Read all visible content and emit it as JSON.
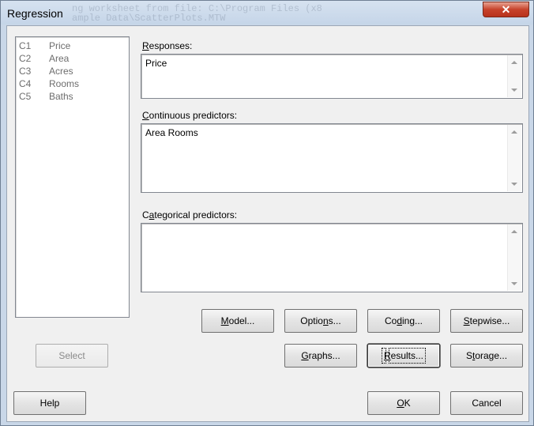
{
  "window": {
    "title": "Regression",
    "close_glyph": "✕",
    "background_ghost_text": "ng worksheet from file: C:\\Program Files (x8\nample Data\\ScatterPlots.MTW"
  },
  "variables": [
    {
      "col": "C1",
      "name": "Price"
    },
    {
      "col": "C2",
      "name": "Area"
    },
    {
      "col": "C3",
      "name": "Acres"
    },
    {
      "col": "C4",
      "name": "Rooms"
    },
    {
      "col": "C5",
      "name": "Baths"
    }
  ],
  "fields": {
    "responses": {
      "label_pre": "",
      "label_hot": "R",
      "label_post": "esponses:",
      "value": "Price"
    },
    "continuous": {
      "label_pre": "",
      "label_hot": "C",
      "label_post": "ontinuous predictors:",
      "value": "Area Rooms"
    },
    "categorical": {
      "label_pre": "C",
      "label_hot": "a",
      "label_post": "tegorical predictors:",
      "value": ""
    }
  },
  "buttons": {
    "model": {
      "pre": "",
      "hot": "M",
      "post": "odel..."
    },
    "options": {
      "pre": "Optio",
      "hot": "n",
      "post": "s..."
    },
    "coding": {
      "pre": "Co",
      "hot": "d",
      "post": "ing..."
    },
    "stepwise": {
      "pre": "",
      "hot": "S",
      "post": "tepwise..."
    },
    "select": {
      "pre": "Select",
      "hot": "",
      "post": ""
    },
    "graphs": {
      "pre": "",
      "hot": "G",
      "post": "raphs..."
    },
    "results": {
      "pre": "",
      "hot": "R",
      "post": "esults..."
    },
    "storage": {
      "pre": "S",
      "hot": "t",
      "post": "orage..."
    },
    "help": {
      "pre": "Help",
      "hot": "",
      "post": ""
    },
    "ok": {
      "pre": "",
      "hot": "O",
      "post": "K"
    },
    "cancel": {
      "pre": "Cancel",
      "hot": "",
      "post": ""
    }
  },
  "icons": {
    "scroll_up": "arrow-up-icon",
    "scroll_down": "arrow-down-icon",
    "close": "close-icon"
  }
}
